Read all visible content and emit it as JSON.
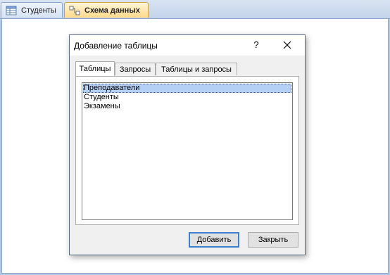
{
  "doc_tabs": [
    {
      "label": "Студенты",
      "icon": "table-icon"
    },
    {
      "label": "Схема данных",
      "icon": "relationships-icon"
    }
  ],
  "dialog": {
    "title": "Добавление таблицы",
    "help_label": "?",
    "tabs": [
      {
        "label": "Таблицы",
        "active": true
      },
      {
        "label": "Запросы",
        "active": false
      },
      {
        "label": "Таблицы и запросы",
        "active": false
      }
    ],
    "list_items": [
      "Преподаватели",
      "Студенты",
      "Экзамены"
    ],
    "selected_item": "Преподаватели",
    "add_button": "Добавить",
    "close_button": "Закрыть"
  },
  "colors": {
    "active_tab": "#ffd98a",
    "selection": "#b4d0f5",
    "default_button_border": "#3c7fd1"
  }
}
